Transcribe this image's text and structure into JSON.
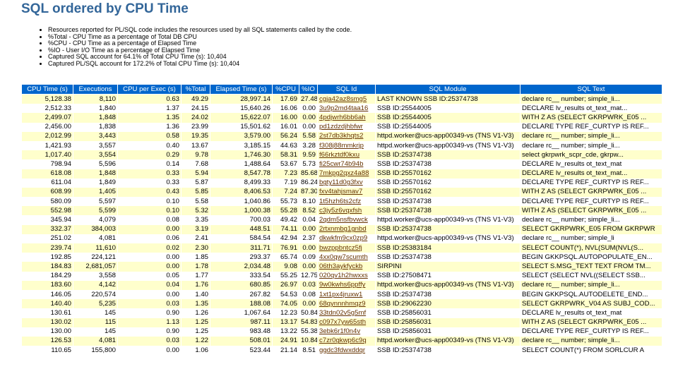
{
  "page": {
    "title": "SQL ordered by CPU Time",
    "notes": [
      "Resources reported for PL/SQL code includes the resources used by all SQL statements called by the code.",
      "%Total - CPU Time as a percentage of Total DB CPU",
      "%CPU - CPU Time as a percentage of Elapsed Time",
      "%IO - User I/O Time as a percentage of Elapsed Time",
      "Captured SQL account for 64.1% of Total CPU Time (s): 10,404",
      "Captured PL/SQL account for 172.2% of Total CPU Time (s): 10,404"
    ]
  },
  "colors": {
    "title": "#336699",
    "header_bg": "#0066cc",
    "row_alt": "#ffffcc",
    "sql_id_link": "#663300"
  },
  "table": {
    "headers": [
      "CPU Time (s)",
      "Executions",
      "CPU per Exec (s)",
      "%Total",
      "Elapsed Time (s)",
      "%CPU",
      "%IO",
      "SQL Id",
      "SQL Module",
      "SQL Text"
    ],
    "rows": [
      [
        "5,128.38",
        "8,110",
        "0.63",
        "49.29",
        "28,997.14",
        "17.69",
        "27.48",
        "cgja42az8smg5",
        "LAST KNOWN SSB ID:25374738",
        "declare rc__ number; simple_li..."
      ],
      [
        "2,512.33",
        "1,840",
        "1.37",
        "24.15",
        "15,640.26",
        "16.06",
        "0.00",
        "3u9p2md4taa16",
        "SSB ID:25544005",
        "DECLARE lv_results ot_text_mat..."
      ],
      [
        "2,499.07",
        "1,848",
        "1.35",
        "24.02",
        "15,622.07",
        "16.00",
        "0.00",
        "4pdjwrh6bb6ah",
        "SSB ID:25544005",
        "WITH Z AS (SELECT GKRPWRK_E05 ..."
      ],
      [
        "2,456.00",
        "1,838",
        "1.36",
        "23.99",
        "15,501.62",
        "16.01",
        "0.00",
        "pd1zdzdjhbfwr",
        "SSB ID:25544005",
        "DECLARE TYPE REF_CURTYP IS REF..."
      ],
      [
        "2,012.99",
        "3,443",
        "0.58",
        "19.35",
        "3,579.00",
        "56.24",
        "5.58",
        "2st7db3khqts2",
        "httpd.worker@ucs-app00349-vs (TNS V1-V3)",
        "declare rc__ number; simple_li..."
      ],
      [
        "1,421.93",
        "3,557",
        "0.40",
        "13.67",
        "3,185.15",
        "44.63",
        "3.28",
        "f308j88mmkrjp",
        "httpd.worker@ucs-app00349-vs (TNS V1-V3)",
        "declare rc__ number; simple_li..."
      ],
      [
        "1,017.40",
        "3,554",
        "0.29",
        "9.78",
        "1,746.30",
        "58.31",
        "9.59",
        "f66rkztdf0kxu",
        "SSB ID:25374738",
        "select gkrpwrk_scpr_cde, gkrpw..."
      ],
      [
        "798.94",
        "5,596",
        "0.14",
        "7.68",
        "1,488.64",
        "53.67",
        "5.73",
        "fi25cwr74b94b",
        "SSB ID:25374738",
        "DECLARE lv_results ot_text_mat"
      ],
      [
        "618.08",
        "1,848",
        "0.33",
        "5.94",
        "8,547.78",
        "7.23",
        "85.68",
        "7mkpg2qxz4a88",
        "SSB ID:25570162",
        "DECLARE lv_results ot_text_mat..."
      ],
      [
        "611.04",
        "1,849",
        "0.33",
        "5.87",
        "8,499.33",
        "7.19",
        "86.24",
        "bgty11d0g3fxv",
        "SSB ID:25570162",
        "DECLARE TYPE REF_CURTYP IS REF..."
      ],
      [
        "608.99",
        "1,405",
        "0.43",
        "5.85",
        "8,406.53",
        "7.24",
        "87.30",
        "fxv4tahjsmav7",
        "SSB ID:25570162",
        "WITH Z AS (SELECT GKRPWRK_E05 ..."
      ],
      [
        "580.09",
        "5,597",
        "0.10",
        "5.58",
        "1,040.86",
        "55.73",
        "8.10",
        "1t5hzh6ts2cfz",
        "SSB ID:25374738",
        "DECLARE TYPE REF_CURTYP IS REF..."
      ],
      [
        "552.98",
        "5,599",
        "0.10",
        "5.32",
        "1,000.38",
        "55.28",
        "8.52",
        "c3jy5z6vqxfsh",
        "SSB ID:25374738",
        "WITH Z AS (SELECT GKRPWRK_E05 ..."
      ],
      [
        "345.94",
        "4,079",
        "0.08",
        "3.35",
        "700.03",
        "49.42",
        "0.04",
        "2qdm5nsfbvwck",
        "httpd.worker@ucs-app00349-vs (TNS V1-V3)",
        "declare rc__ number; simple_li..."
      ],
      [
        "332.37",
        "384,003",
        "0.00",
        "3.19",
        "448.51",
        "74.11",
        "0.00",
        "2rtxnmbg1gnbd",
        "SSB ID:25374738",
        "SELECT GKRPWRK_E05 FROM GKRPWR"
      ],
      [
        "251.02",
        "4,081",
        "0.06",
        "2.41",
        "584.54",
        "42.94",
        "2.37",
        "dkwkfm9cx0zp9",
        "httpd.worker@ucs-app00349-vs (TNS V1-V3)",
        "declare rc__ number; simple_li"
      ],
      [
        "239.74",
        "11,610",
        "0.02",
        "2.30",
        "311.71",
        "76.91",
        "0.00",
        "bwzppbntcz5fj",
        "SSB ID:25383184",
        "SELECT COUNT(*), NVL(SUM(NVL(S..."
      ],
      [
        "192.85",
        "224,121",
        "0.00",
        "1.85",
        "293.37",
        "65.74",
        "0.09",
        "4xx0qw7scumth",
        "SSB ID:25374738",
        "BEGIN GKKPSQL.AUTOPOPULATE_EN..."
      ],
      [
        "184.83",
        "2,681,057",
        "0.00",
        "1.78",
        "2,034.48",
        "9.08",
        "0.00",
        "06th3aykfyckb",
        "SIRPINI",
        "SELECT S.MSG_TEXT TEXT FROM TM..."
      ],
      [
        "184.29",
        "3,558",
        "0.05",
        "1.77",
        "333.54",
        "55.25",
        "12.75",
        "020qv1h2hwxxs",
        "SSB ID:27508471",
        "SELECT (SELECT NVL((SELECT SSB..."
      ],
      [
        "183.60",
        "4,142",
        "0.04",
        "1.76",
        "680.85",
        "26.97",
        "0.03",
        "9w0kwhs6ppffy",
        "httpd.worker@ucs-app00349-vs (TNS V1-V3)",
        "declare rc__ number; simple_li..."
      ],
      [
        "146.05",
        "220,574",
        "0.00",
        "1.40",
        "267.82",
        "54.53",
        "0.08",
        "1xt1px4jruxw1",
        "SSB ID:25374738",
        "BEGIN GKKPSQL.AUTODELETE_END..."
      ],
      [
        "140.40",
        "5,235",
        "0.03",
        "1.35",
        "188.08",
        "74.05",
        "0.00",
        "68qynnnhmqz9",
        "SSB ID:29062230",
        "SELECT GKRPWRK_V04 AS SUBJ_COD..."
      ],
      [
        "130.61",
        "145",
        "0.90",
        "1.26",
        "1,067.64",
        "12.23",
        "50.84",
        "33tdn02v5g5mf",
        "SSB ID:25856031",
        "DECLARE lv_results ot_text_mat"
      ],
      [
        "130.02",
        "115",
        "1.13",
        "1.25",
        "987.11",
        "13.17",
        "54.83",
        "c097x7yw65sth",
        "SSB ID:25856031",
        "WITH Z AS (SELECT GKRPWRK_E05 ..."
      ],
      [
        "130.00",
        "145",
        "0.90",
        "1.25",
        "983.48",
        "13.22",
        "55.38",
        "3ebk6r1f0n4v",
        "SSB ID:25856031",
        "DECLARE TYPE REF_CURTYP IS REF..."
      ],
      [
        "126.53",
        "4,081",
        "0.03",
        "1.22",
        "508.01",
        "24.91",
        "10.84",
        "c7zr0gkwp6c9q",
        "httpd.worker@ucs-app00349-vs (TNS V1-V3)",
        "declare rc__ number; simple_li..."
      ],
      [
        "110.65",
        "155,800",
        "0.00",
        "1.06",
        "523.44",
        "21.14",
        "8.51",
        "ggdc3fdwxddqr",
        "SSB ID:25374738",
        "SELECT COUNT(*) FROM SORLCUR A"
      ]
    ]
  }
}
